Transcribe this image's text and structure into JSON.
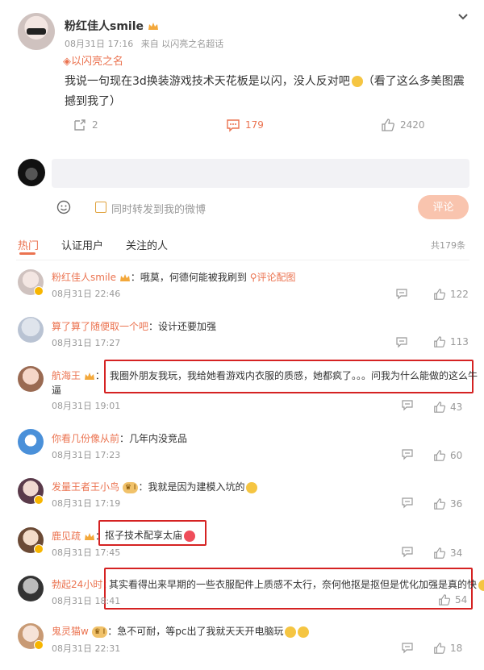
{
  "post": {
    "author": "粉红佳人smile",
    "date": "08月31日 17:16",
    "source": "来自 以闪亮之名超话",
    "topic": "以闪亮之名",
    "body": "我说一句现在3d换装游戏技术天花板是以闪，没人反对吧",
    "body_suffix": "（看了这么多美图震撼到我了）",
    "reposts": "2",
    "comments": "179",
    "likes": "2420"
  },
  "composer": {
    "placeholder": "",
    "forward_label": "同时转发到我的微博",
    "submit_label": "评论"
  },
  "tabs": {
    "hot": "热门",
    "verified": "认证用户",
    "following": "关注的人",
    "total": "共179条"
  },
  "comments": [
    {
      "name": "粉红佳人smile",
      "text": "哦莫，何德何能被我刷到",
      "link": "评论配图",
      "time": "08月31日 22:46",
      "likes": "122"
    },
    {
      "name": "算了算了随便取一个吧",
      "text": "设计还要加强",
      "time": "08月31日 17:27",
      "likes": "113"
    },
    {
      "name": "航海王",
      "text": "我圈外朋友我玩，我给她看游戏内衣服的质感，她都疯了。。。问我为什么能做的这么牛",
      "text2": "逼",
      "time": "08月31日 19:01",
      "likes": "43"
    },
    {
      "name": "你看几份像从前",
      "text": "几年内没竞品",
      "time": "08月31日 17:23",
      "likes": "60"
    },
    {
      "name": "发量王者王小鸟",
      "text": "我就是因为建模入坑的",
      "time": "08月31日 17:19",
      "likes": "36"
    },
    {
      "name": "鹿见疏",
      "text": "抠子技术配享太庙",
      "time": "08月31日 17:45",
      "likes": "34"
    },
    {
      "name": "勃起24小时",
      "text": "其实看得出来早期的一些衣服配件上质感不太行，奈何他抠是抠但是优化加强是真的快",
      "time": "08月31日 18:41",
      "likes": "54"
    },
    {
      "name": "鬼灵猫w",
      "text": "急不可耐，等pc出了我就天天开电脑玩",
      "time": "08月31日 22:31",
      "likes": "18"
    }
  ],
  "colors": {
    "accent": "#eb7350",
    "highlight_box": "#d52222",
    "muted": "#999999",
    "input_bg": "#f2f2f5",
    "submit_bg": "#f9c4ae"
  }
}
